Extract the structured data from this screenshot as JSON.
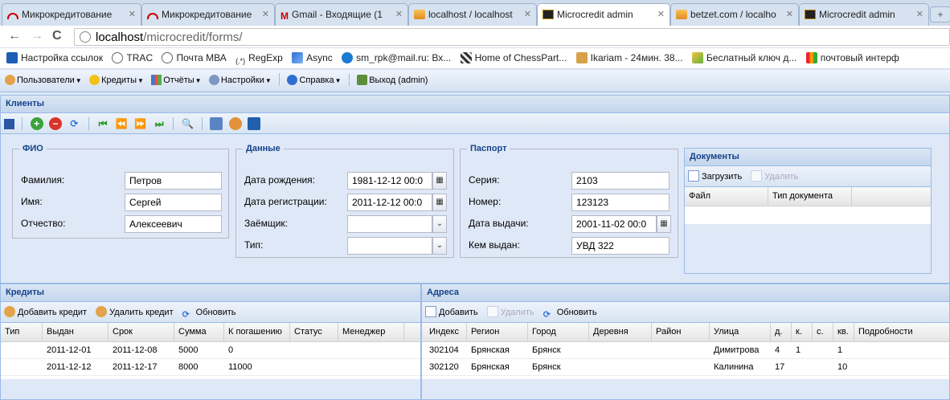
{
  "browser": {
    "tabs": [
      {
        "title": "Микрокредитование",
        "icon": "arc-icon"
      },
      {
        "title": "Микрокредитование",
        "icon": "arc-icon"
      },
      {
        "title": "Gmail - Входящие (1",
        "icon": "gmail-icon"
      },
      {
        "title": "localhost / localhost",
        "icon": "pma-icon"
      },
      {
        "title": "Microcredit admin",
        "icon": "microcredit-icon"
      },
      {
        "title": "betzet.com / localho",
        "icon": "pma-icon"
      },
      {
        "title": "Microcredit admin",
        "icon": "microcredit-icon"
      }
    ],
    "url_host": "localhost",
    "url_path": "/microcredit/forms/",
    "bookmarks": [
      "Настройка ссылок",
      "TRAC",
      "Почта МВА",
      "RegExp",
      "Async",
      "sm_rpk@mail.ru: Вх...",
      "Home of ChessPart...",
      "Ikariam - 24мин. 38...",
      "Беслатный ключ д...",
      "почтовый интерф"
    ]
  },
  "menu": {
    "users": "Пользователи",
    "credits": "Кредиты",
    "reports": "Отчёты",
    "settings": "Настройки",
    "help": "Справка",
    "logout": "Выход (admin)"
  },
  "clients": {
    "title": "Клиенты",
    "fio": {
      "legend": "ФИО",
      "last_name_label": "Фамилия:",
      "last_name": "Петров",
      "first_name_label": "Имя:",
      "first_name": "Сергей",
      "patronymic_label": "Отчество:",
      "patronymic": "Алексеевич"
    },
    "data": {
      "legend": "Данные",
      "birth_label": "Дата рождения:",
      "birth": "1981-12-12 00:0",
      "reg_label": "Дата регистрации:",
      "reg": "2011-12-12 00:0",
      "borrower_label": "Заёмщик:",
      "borrower": "",
      "type_label": "Тип:",
      "type": ""
    },
    "passport": {
      "legend": "Паспорт",
      "series_label": "Серия:",
      "series": "2103",
      "number_label": "Номер:",
      "number": "123123",
      "issued_label": "Дата выдачи:",
      "issued": "2001-11-02 00:0",
      "by_label": "Кем выдан:",
      "by": "УВД 322"
    },
    "documents": {
      "title": "Документы",
      "upload": "Загрузить",
      "delete": "Удалить",
      "columns": [
        "Файл",
        "Тип документа"
      ]
    }
  },
  "credits": {
    "title": "Кредиты",
    "add": "Добавить кредит",
    "delete": "Удалить кредит",
    "refresh": "Обновить",
    "columns": [
      "Тип",
      "Выдан",
      "Срок",
      "Сумма",
      "К погашению",
      "Статус",
      "Менеджер"
    ],
    "rows": [
      [
        "",
        "2011-12-01",
        "2011-12-08",
        "5000",
        "0",
        "",
        ""
      ],
      [
        "",
        "2011-12-12",
        "2011-12-17",
        "8000",
        "11000",
        "",
        ""
      ]
    ]
  },
  "addresses": {
    "title": "Адреса",
    "add": "Добавить",
    "delete": "Удалить",
    "refresh": "Обновить",
    "columns": [
      "Индекс",
      "Регион",
      "Город",
      "Деревня",
      "Район",
      "Улица",
      "д.",
      "к.",
      "с.",
      "кв.",
      "Подробности"
    ],
    "rows": [
      [
        "302104",
        "Брянская",
        "Брянск",
        "",
        "",
        "Димитрова",
        "4",
        "1",
        "",
        "1",
        ""
      ],
      [
        "302120",
        "Брянская",
        "Брянск",
        "",
        "",
        "Калинина",
        "17",
        "",
        "",
        "10",
        ""
      ]
    ]
  }
}
